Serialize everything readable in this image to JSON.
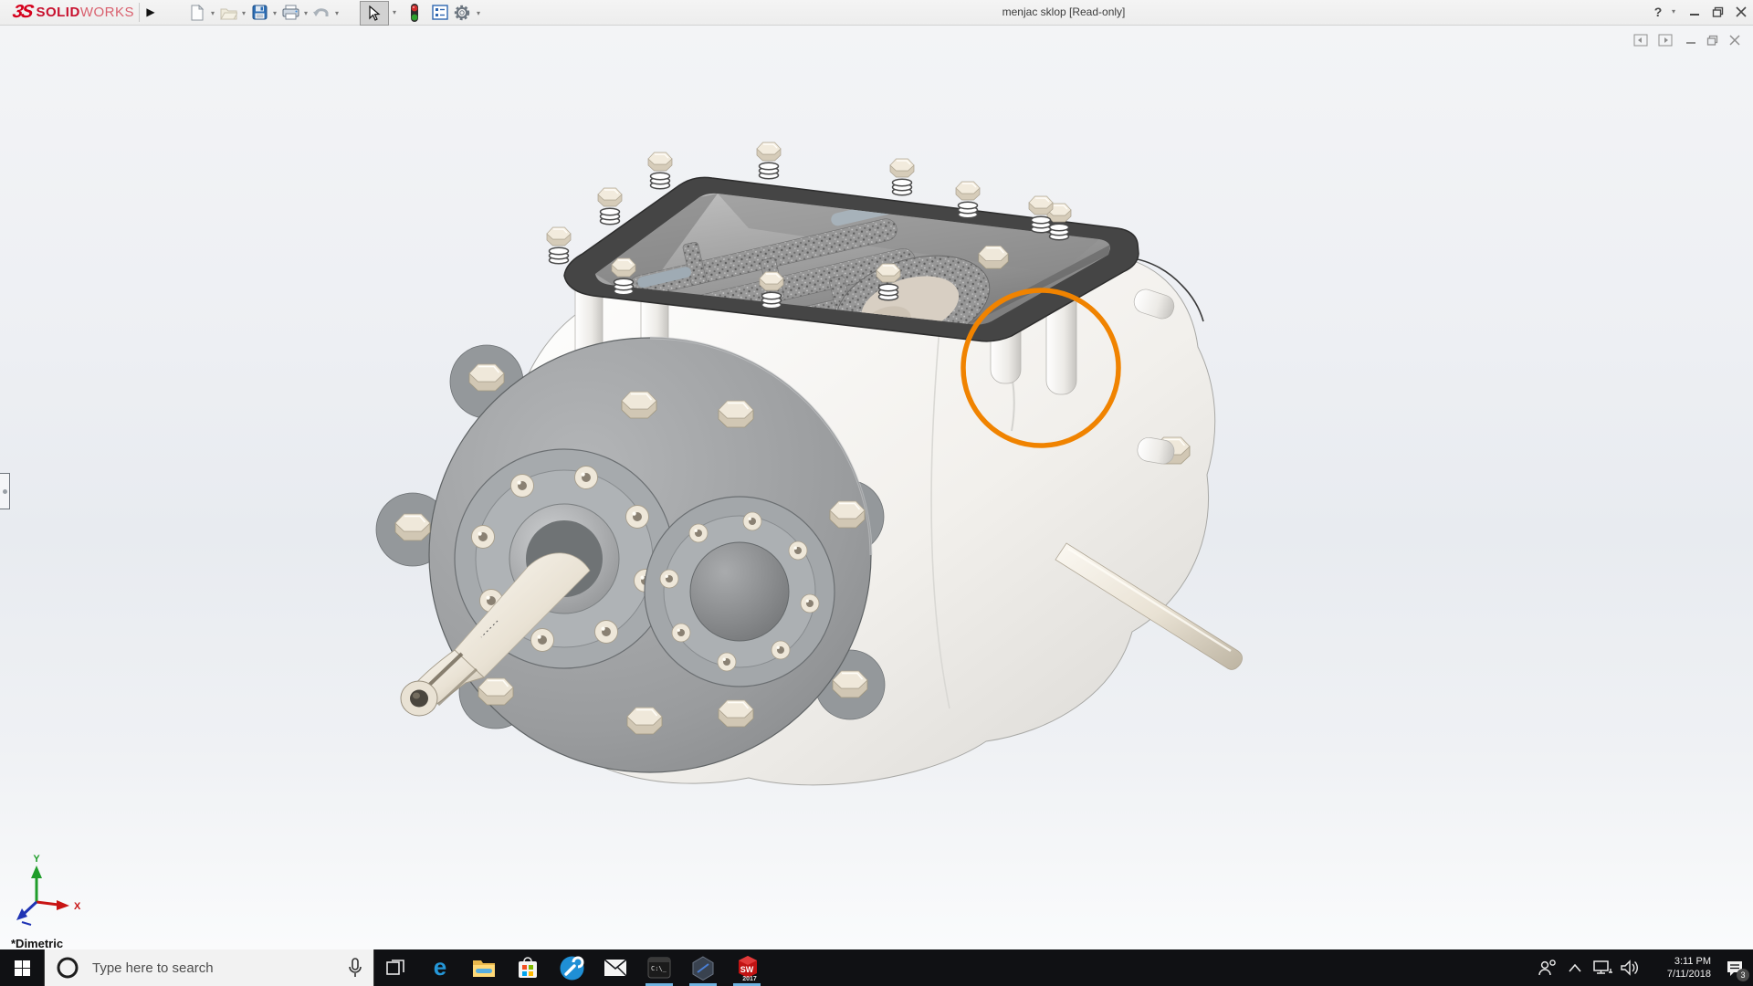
{
  "titlebar": {
    "brand": {
      "mark": "3S",
      "bold": "SOLID",
      "light": "WORKS"
    },
    "flyout_glyph": "▶",
    "caret_glyph": "▾",
    "title": "menjac sklop [Read-only]",
    "help_glyph": "?",
    "toolbar_items": [
      "new-document",
      "open",
      "save",
      "print",
      "undo",
      "select",
      "rebuild",
      "file-properties",
      "options"
    ]
  },
  "doc_window_controls": [
    "previous-pane",
    "next-pane",
    "minimize-document",
    "restore-document",
    "close-document"
  ],
  "viewport": {
    "view_label": "*Dimetric",
    "triad": {
      "x_label": "X",
      "y_label": "Y"
    },
    "annotation_circle_color": "#F08300"
  },
  "taskbar": {
    "search_placeholder": "Type here to search",
    "apps": [
      "task-view",
      "edge",
      "file-explorer",
      "microsoft-store",
      "support-app",
      "mail",
      "command-prompt",
      "developer-app",
      "solidworks-2017"
    ],
    "running_apps": [
      "command-prompt",
      "developer-app",
      "solidworks-2017"
    ],
    "edge_glyph": "e",
    "cmd_glyph": "C:\\_",
    "solidworks_badge": {
      "line1": "SW",
      "line2": "2017"
    },
    "tray": {
      "time": "3:11 PM",
      "date": "7/11/2018",
      "notifications_badge": "3"
    }
  },
  "colors": {
    "annotation_orange": "#F08300",
    "brand_red": "#C8102E",
    "titlebar_bg": "#F0F0F0",
    "taskbar_bg": "#101114",
    "running_underline": "#6FB3E0"
  }
}
